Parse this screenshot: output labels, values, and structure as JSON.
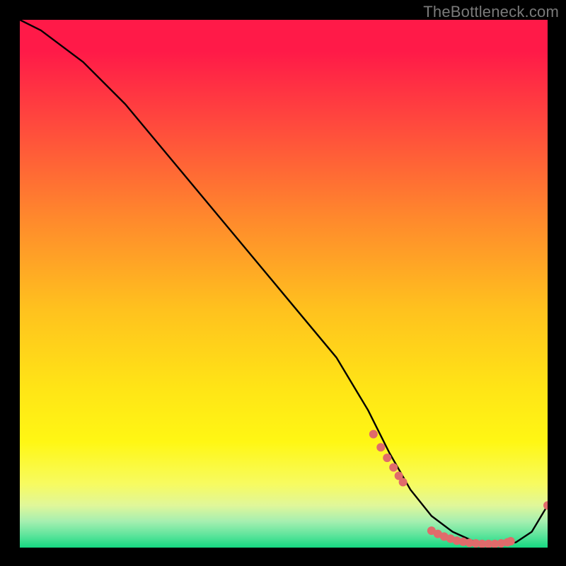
{
  "watermark": "TheBottleneck.com",
  "chart_data": {
    "type": "line",
    "title": "",
    "xlabel": "",
    "ylabel": "",
    "xlim": [
      0,
      100
    ],
    "ylim": [
      0,
      100
    ],
    "grid": false,
    "legend": false,
    "series": [
      {
        "name": "curve",
        "x": [
          0,
          4,
          8,
          12,
          20,
          30,
          40,
          50,
          60,
          66,
          70,
          74,
          78,
          82,
          86,
          90,
          94,
          97,
          100
        ],
        "y": [
          100,
          98,
          95,
          92,
          84,
          72,
          60,
          48,
          36,
          26,
          18,
          11,
          6,
          3,
          1.2,
          0.6,
          1.0,
          3.0,
          8.0
        ]
      }
    ],
    "markers": [
      {
        "name": "cluster-descent",
        "x": [
          67.0,
          68.4,
          69.6,
          70.8,
          71.8,
          72.6
        ],
        "y": [
          21.5,
          19.0,
          17.0,
          15.2,
          13.6,
          12.4
        ]
      },
      {
        "name": "cluster-bottom",
        "x": [
          78.0,
          79.2,
          80.4,
          81.6,
          82.8,
          84.0,
          85.2,
          86.4,
          87.6,
          88.8,
          90.0,
          91.2,
          92.4,
          93.0
        ],
        "y": [
          3.2,
          2.6,
          2.1,
          1.7,
          1.3,
          1.1,
          0.9,
          0.8,
          0.7,
          0.7,
          0.7,
          0.8,
          1.0,
          1.2
        ]
      },
      {
        "name": "end-point",
        "x": [
          100.0
        ],
        "y": [
          8.0
        ]
      }
    ],
    "styles": {
      "line_color": "#000000",
      "line_width": 2.4,
      "marker_color": "#e06b6b",
      "marker_radius": 6
    }
  }
}
